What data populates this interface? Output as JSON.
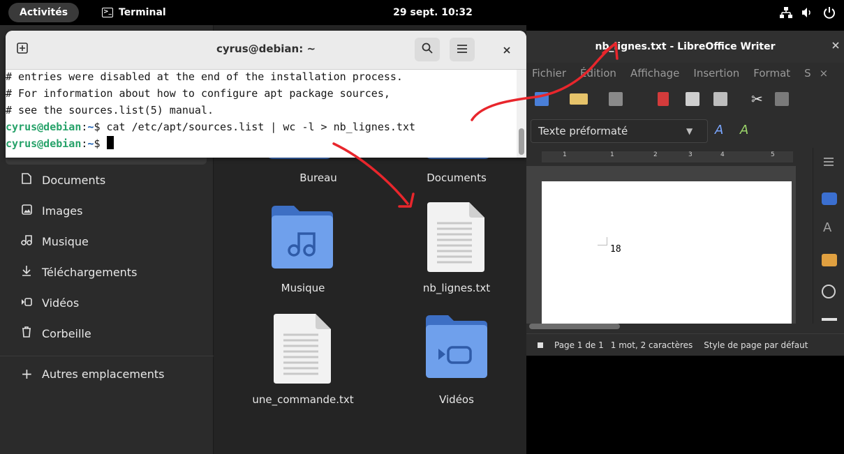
{
  "topbar": {
    "activities": "Activités",
    "app_name": "Terminal",
    "clock": "29 sept. 10:32",
    "tray_icons": [
      "network-icon",
      "volume-icon",
      "power-icon"
    ]
  },
  "files": {
    "sidebar": [
      {
        "label": "Documents",
        "icon": "document-icon"
      },
      {
        "label": "Images",
        "icon": "image-icon"
      },
      {
        "label": "Musique",
        "icon": "music-icon"
      },
      {
        "label": "Téléchargements",
        "icon": "download-icon"
      },
      {
        "label": "Vidéos",
        "icon": "video-icon"
      },
      {
        "label": "Corbeille",
        "icon": "trash-icon"
      }
    ],
    "other_locations": "Autres emplacements",
    "items": [
      {
        "name": "Bureau",
        "type": "folder"
      },
      {
        "name": "Documents",
        "type": "folder"
      },
      {
        "name": "Musique",
        "type": "folder"
      },
      {
        "name": "nb_lignes.txt",
        "type": "text-file"
      },
      {
        "name": "une_commande.txt",
        "type": "text-file"
      },
      {
        "name": "Vidéos",
        "type": "folder"
      }
    ],
    "colors": {
      "folder": "#4a86e8",
      "folder_dark": "#3d6fc4",
      "background": "#242424"
    }
  },
  "terminal": {
    "title": "cyrus@debian: ~",
    "lines": [
      "# entries were disabled at the end of the installation process.",
      "# For information about how to configure apt package sources,",
      "# see the sources.list(5) manual."
    ],
    "prompt_user": "cyrus@debian",
    "prompt_sep": ":",
    "prompt_path": "~",
    "prompt_symbol": "$ ",
    "command": "cat /etc/apt/sources.list | wc -l > nb_lignes.txt",
    "current_input": ""
  },
  "writer": {
    "title": "nb_lignes.txt - LibreOffice Writer",
    "menu": [
      "Fichier",
      "Édition",
      "Affichage",
      "Insertion",
      "Format",
      "S"
    ],
    "paragraph_style": "Texte préformaté",
    "document_text": "18",
    "status": {
      "page": "Page 1 de 1",
      "words": "1 mot, 2 caractères",
      "page_style": "Style de page par défaut"
    },
    "ruler_ticks": [
      "1",
      "1",
      "2",
      "3",
      "4",
      "5"
    ]
  },
  "annotation_color": "#e8262c"
}
